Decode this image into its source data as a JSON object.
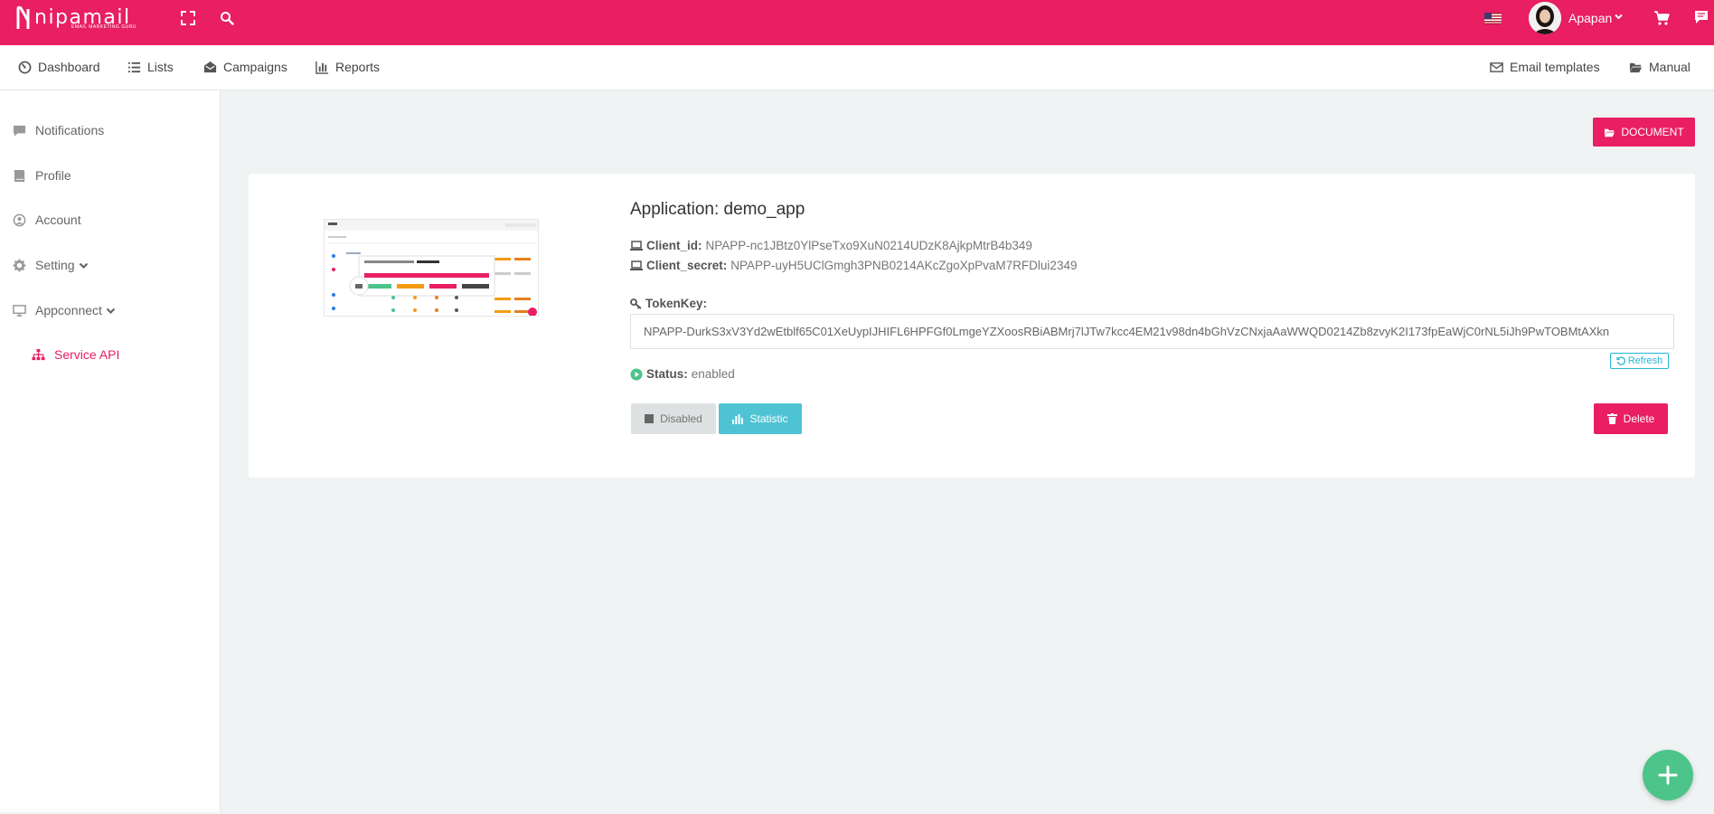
{
  "brand": {
    "name": "nipamail",
    "tagline": "EMAIL MARKETING GURU"
  },
  "topbar": {
    "user_name": "Apapan"
  },
  "menu": {
    "left": [
      {
        "label": "Dashboard",
        "icon": "dashboard-icon"
      },
      {
        "label": "Lists",
        "icon": "list-icon"
      },
      {
        "label": "Campaigns",
        "icon": "envelope-open-icon"
      },
      {
        "label": "Reports",
        "icon": "bar-chart-icon"
      }
    ],
    "right": [
      {
        "label": "Email templates",
        "icon": "envelope-icon"
      },
      {
        "label": "Manual",
        "icon": "folder-open-icon"
      }
    ]
  },
  "sidebar": {
    "items": [
      {
        "label": "Notifications",
        "icon": "comment-icon"
      },
      {
        "label": "Profile",
        "icon": "book-icon"
      },
      {
        "label": "Account",
        "icon": "user-circle-icon"
      },
      {
        "label": "Setting",
        "icon": "gear-icon"
      },
      {
        "label": "Appconnect",
        "icon": "monitor-icon"
      },
      {
        "label": "Service API",
        "icon": "sitemap-icon",
        "active": true
      }
    ]
  },
  "main": {
    "document_button": "DOCUMENT",
    "app_title": "Application: demo_app",
    "client_id_label": "Client_id:",
    "client_id": "NPAPP-nc1JBtz0YlPseTxo9XuN0214UDzK8AjkpMtrB4b349",
    "client_secret_label": "Client_secret:",
    "client_secret": "NPAPP-uyH5UClGmgh3PNB0214AKcZgoXpPvaM7RFDlui2349",
    "token_label": "TokenKey:",
    "token_value": "NPAPP-DurkS3xV3Yd2wEtblf65C01XeUypIJHIFL6HPFGf0LmgeYZXoosRBiABMrj7lJTw7kcc4EM21v98dn4bGhVzCNxjaAaWWQD0214Zb8zvyK2I173fpEaWjC0rNL5iJh9PwTOBMtAXkn",
    "refresh_label": "Refresh",
    "status_label": "Status:",
    "status_value": "enabled",
    "disabled_button": "Disabled",
    "statistic_button": "Statistic",
    "delete_button": "Delete"
  },
  "colors": {
    "primary": "#e91e63",
    "accent": "#4fc3d4",
    "success": "#4cc48a",
    "background": "#f0f3f3"
  }
}
